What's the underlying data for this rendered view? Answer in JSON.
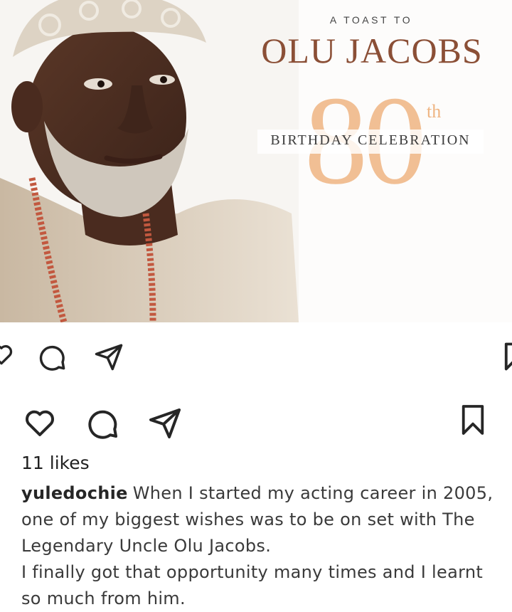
{
  "banner": {
    "subtitle": "A TOAST TO",
    "name": "OLU JACOBS",
    "anniversary_number": "80",
    "anniversary_suffix": "th",
    "event": "BIRTHDAY CELEBRATION"
  },
  "top_action_bar": {
    "icons": [
      "heart-icon",
      "comment-icon",
      "share-icon",
      "bookmark-icon"
    ]
  },
  "main_action_bar": {
    "icons": [
      "heart-icon",
      "comment-icon",
      "share-icon",
      "bookmark-icon"
    ]
  },
  "post": {
    "likes": "11 likes",
    "username": "yuledochie",
    "caption_line1": "When I started my acting career in 2005, one of my biggest wishes was to be on set with The Legendary Uncle Olu Jacobs.",
    "caption_line2": "I finally got that opportunity many times and I learnt so much from him."
  },
  "colors": {
    "name_color": "#8b4f36",
    "number_color": "#efb583",
    "icon_color": "#262626"
  }
}
